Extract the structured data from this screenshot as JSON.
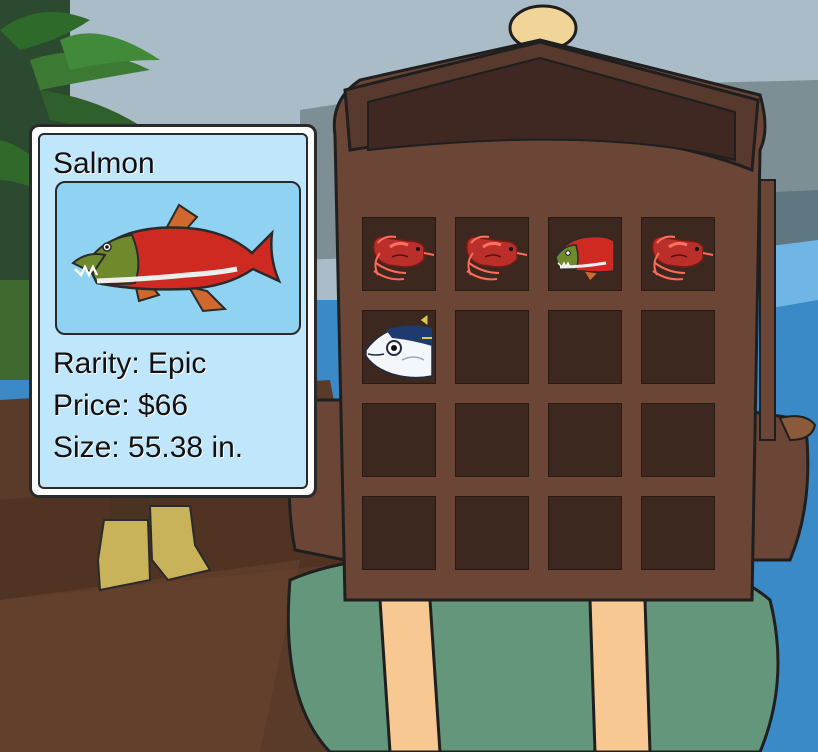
{
  "tooltip": {
    "title": "Salmon",
    "image_icon": "salmon-icon",
    "rarity": "Rarity: Epic",
    "price": "Price: $66",
    "size": "Size: 55.38 in."
  },
  "inventory": {
    "rows": 4,
    "columns": 4,
    "slots": [
      {
        "item": "shrimp-icon"
      },
      {
        "item": "shrimp-icon"
      },
      {
        "item": "salmon-icon"
      },
      {
        "item": "shrimp-icon"
      },
      {
        "item": "tuna-icon"
      },
      {
        "item": null
      },
      {
        "item": null
      },
      {
        "item": null
      },
      {
        "item": null
      },
      {
        "item": null
      },
      {
        "item": null
      },
      {
        "item": null
      },
      {
        "item": null
      },
      {
        "item": null
      },
      {
        "item": null
      },
      {
        "item": null
      }
    ]
  },
  "colors": {
    "backpack": "#6b4636",
    "slot": "#3d2820",
    "bedroll": "#64967c",
    "strap": "#f8c893",
    "tooltip_bg": "#bfe6fb",
    "salmon_red": "#cf2a22",
    "salmon_head": "#6f8a2c"
  }
}
